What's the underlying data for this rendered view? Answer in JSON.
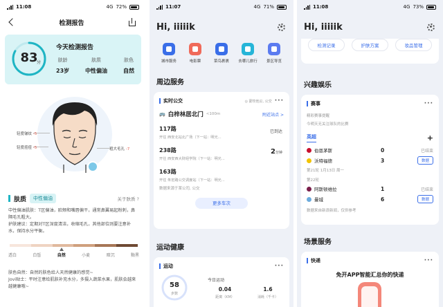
{
  "status": [
    {
      "time": "11:08",
      "net": "4G",
      "battery": "72%"
    },
    {
      "time": "11:07",
      "net": "4G",
      "battery": "71%"
    },
    {
      "time": "11:08",
      "net": "4G",
      "battery": "73%"
    }
  ],
  "report": {
    "title": "检测报告",
    "score": "83",
    "score_unit": "分",
    "score_fraction": 0.83,
    "today_label": "今天检测报告",
    "metrics": [
      {
        "label": "肤龄",
        "value": "23岁"
      },
      {
        "label": "肤质",
        "value": "中性偏油"
      },
      {
        "label": "肤色",
        "value": "自然"
      }
    ],
    "tags": [
      {
        "text": "轻度皱纹",
        "num": "-5"
      },
      {
        "text": "轻度痘痘",
        "num": "-5"
      },
      {
        "text": "粗大毛孔",
        "num": "-7"
      }
    ],
    "skin_title": "肤质",
    "skin_tag": "中性偏油",
    "about": "关于肤质 ?",
    "desc1": "中性偏油肌肤：T区偏油，脸颊和嘴唇偏干，通常鼻翼易起粉刺，鼻隔毛孔粗大。",
    "desc2": "护肤建议：定期对T区深度清洁，收缩毛孔，其他部位则要注意补水，保持水分平衡。",
    "scale_labels": [
      "透白",
      "白皙",
      "自然",
      "小麦",
      "暗沉",
      "黝黑"
    ],
    "color_desc": "肤色自然：自然的肤色给人天然健康的感觉~",
    "tip": "Jovi贴士：平时注意给肌肤补充水分，多摄入蔬菜水果，肌肤会越来越健康哦~",
    "colors": {
      "accent": "#1fb5c4"
    }
  },
  "home": {
    "greeting": "Hi, iiiiik",
    "quick": [
      {
        "label": "城市服务",
        "color": "#3a6ee8"
      },
      {
        "label": "电影票",
        "color": "#f06a5a"
      },
      {
        "label": "菜鸟裹裹",
        "color": "#3a6ee8"
      },
      {
        "label": "去哪儿旅行",
        "color": "#26b5d8"
      },
      {
        "label": "景区导览",
        "color": "#5b7bf0"
      }
    ],
    "nearby_title": "周边服务",
    "bus": {
      "card_title": "实时公交",
      "location": "◎ 蒙牧他瓜, 公交",
      "stop": "白梓林居北门",
      "dist": "<100m",
      "nearby_link": "附近站点 >",
      "routes": [
        {
          "name": "117路",
          "sub": "开往 西安北站北广场（下一站：明光...",
          "status": "已到达"
        },
        {
          "name": "238路",
          "sub": "开往 西安西大财经学院（下一站：明光...",
          "eta": "2",
          "eta_unit": "分钟"
        },
        {
          "name": "163路",
          "sub": "开往 朱宏路公交调度站（下一站：明光..."
        }
      ],
      "note": "数据来源于某公司, 公交",
      "more": "更多车次"
    },
    "sport_title": "运动健康",
    "sport": {
      "card_title": "运动",
      "steps": "58",
      "steps_unit": "步数",
      "today": "今日运动",
      "distance": "0.04",
      "distance_unit": "距离（KM）",
      "calorie": "1.6",
      "calorie_unit": "消耗（千卡）"
    }
  },
  "home2": {
    "greeting": "Hi, iiiiik",
    "pills": [
      "检测记录",
      "护肤方案",
      "妆品管理"
    ],
    "interest_title": "兴趣娱乐",
    "match": {
      "card_title": "赛事",
      "hint1": "精彩赛事提醒",
      "hint2": "今明天无关注球队的比赛",
      "league": "英超",
      "add": "+",
      "game1": {
        "home": "伯恩茅斯",
        "home_score": "0",
        "away": "沃特福德",
        "away_score": "3",
        "state": "已结束",
        "btn": "数据",
        "date": "第21轮  1月13日 周一"
      },
      "game2": {
        "round": "第22轮",
        "home": "阿斯顿维拉",
        "home_score": "1",
        "away": "曼城",
        "away_score": "6",
        "state": "已结束",
        "btn": "数据"
      },
      "note": "数据来自新浪新闻，仅供参考"
    },
    "scene_title": "场景服务",
    "express": {
      "card_title": "快递",
      "headline": "免开APP智能汇总你的快递"
    }
  }
}
